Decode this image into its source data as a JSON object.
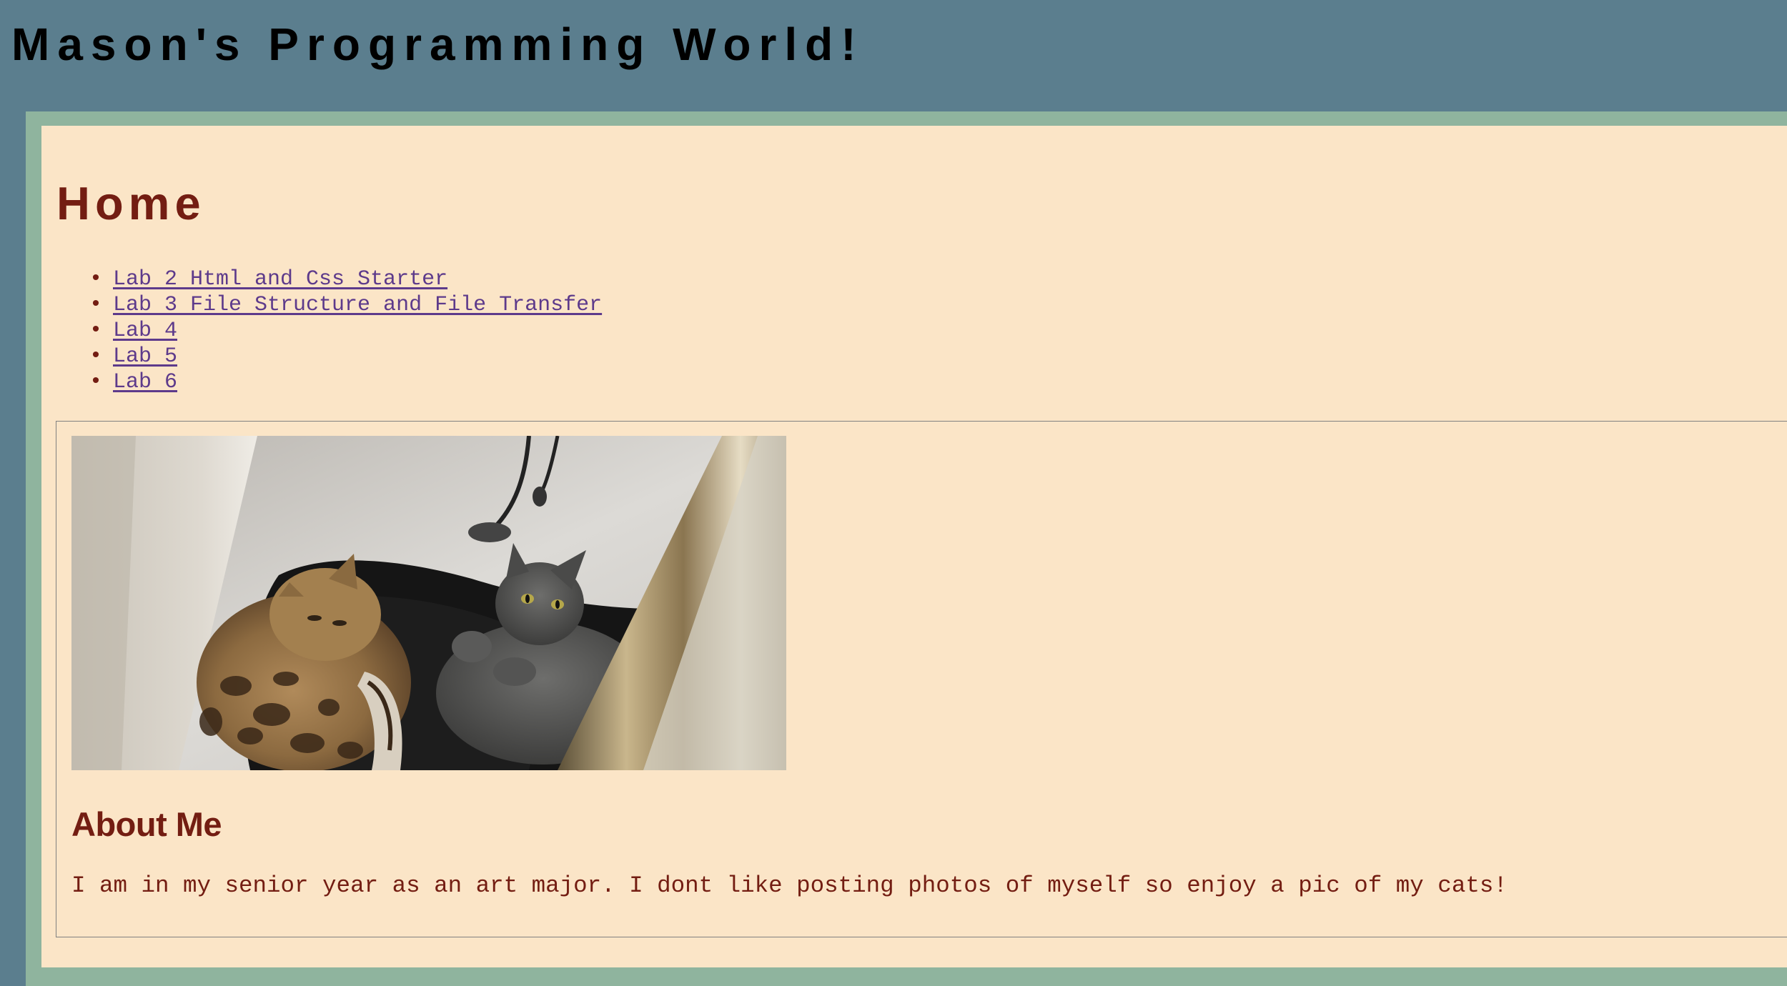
{
  "site": {
    "title": "Mason's Programming World!"
  },
  "page": {
    "title": "Home"
  },
  "nav": {
    "labs": [
      {
        "label": "Lab 2 Html and Css Starter"
      },
      {
        "label": "Lab 3 File Structure and File Transfer"
      },
      {
        "label": "Lab 4"
      },
      {
        "label": "Lab 5"
      },
      {
        "label": "Lab 6"
      }
    ]
  },
  "about": {
    "photo_subject": "two cats lying on a dark cushion in a corner",
    "heading": "About Me",
    "text": "I am in my senior year as an art major. I dont like posting photos of myself so enjoy a pic of my cats!"
  },
  "colors": {
    "page_background": "#5b7e8e",
    "frame_border": "#8fb49e",
    "content_background": "#fbe5c7",
    "heading": "#731d12",
    "link": "#5d3a8b"
  },
  "icons": {
    "list_bullet": "bullet-icon"
  }
}
